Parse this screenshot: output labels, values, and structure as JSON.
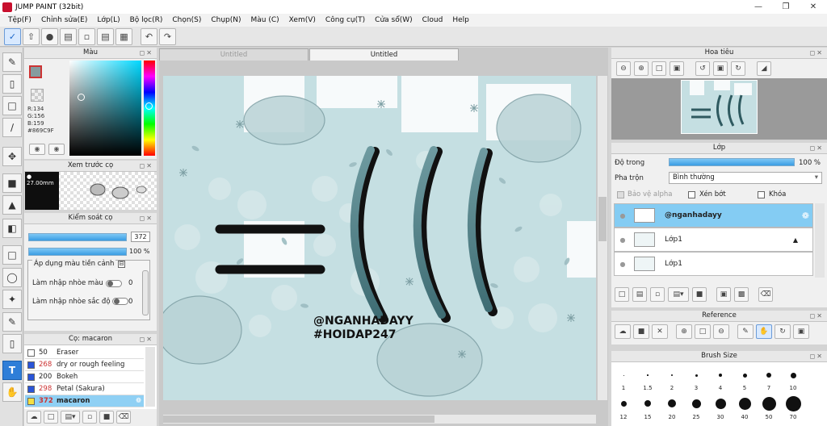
{
  "window": {
    "title": "JUMP PAINT (32bit)"
  },
  "menu": [
    "Tệp(F)",
    "Chỉnh sửa(E)",
    "Lớp(L)",
    "Bộ lọc(R)",
    "Chọn(S)",
    "Chụp(N)",
    "Màu (C)",
    "Xem(V)",
    "Công cụ(T)",
    "Cửa sổ(W)",
    "Cloud",
    "Help"
  ],
  "color_panel": {
    "title": "Màu",
    "r": "R:134",
    "g": "G:156",
    "b": "B:159",
    "hex": "#869C9F",
    "fg_color": "#869C9F"
  },
  "brush_preview": {
    "title": "Xem trước cọ",
    "size": "27.00mm"
  },
  "brush_control": {
    "title": "Kiểm soát cọ",
    "size_value": "372",
    "opacity_value": "100 %",
    "apply_label": "Áp dụng màu tiền cảnh",
    "blur_color_label": "Làm nhập nhòe màu",
    "blur_color_value": "0",
    "blur_density_label": "Làm nhập nhòe sắc độ",
    "blur_density_value": "0"
  },
  "brush_list": {
    "title": "Cọ: macaron",
    "items": [
      {
        "size": "50",
        "name": "Eraser",
        "chip": "#ffffff"
      },
      {
        "size": "268",
        "name": "dry or rough feeling",
        "chip": "#2a55d8"
      },
      {
        "size": "200",
        "name": "Bokeh",
        "chip": "#2a55d8"
      },
      {
        "size": "298",
        "name": "Petal (Sakura)",
        "chip": "#2a55d8"
      },
      {
        "size": "372",
        "name": "macaron",
        "chip": "#f5e040"
      }
    ]
  },
  "tabs": [
    "Untitled",
    "Untitled"
  ],
  "artwork": {
    "line1": "@NGANHADAYY",
    "line2": "#HOIDAP247"
  },
  "navigator": {
    "title": "Hoa tiêu"
  },
  "layers": {
    "title": "Lớp",
    "opacity_label": "Độ trong",
    "opacity_value": "100 %",
    "blend_label": "Pha trộn",
    "blend_value": "Bình thường",
    "protect_alpha": "Bảo vệ alpha",
    "clipping": "Xén bớt",
    "lock": "Khóa",
    "items": [
      {
        "name": "@nganhadayy"
      },
      {
        "name": "Lớp1"
      },
      {
        "name": "Lớp1"
      }
    ]
  },
  "reference": {
    "title": "Reference"
  },
  "brush_size": {
    "title": "Brush Size",
    "labels_row1": [
      "1",
      "1.5",
      "2",
      "3",
      "4",
      "5",
      "7",
      "10"
    ],
    "labels_row2": [
      "12",
      "15",
      "20",
      "25",
      "30",
      "40",
      "50",
      "70"
    ]
  }
}
